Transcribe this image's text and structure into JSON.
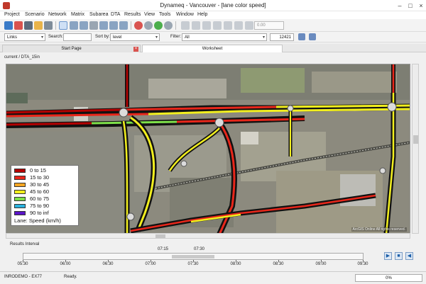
{
  "window": {
    "title": "Dynameq - Vancouver - [lane color speed]"
  },
  "menu": [
    "Project",
    "Scenario",
    "Network",
    "Matrix",
    "Subarea",
    "DTA",
    "Results",
    "View",
    "Tools",
    "Window",
    "Help"
  ],
  "toolbar": {
    "zoom_value": "0.00"
  },
  "filterbar": {
    "layer_select": "Links",
    "search_label": "Search:",
    "search_value": "",
    "sort_label": "Sort by:",
    "sort_value": "level",
    "filter_label": "Filter:",
    "filter_value": "All",
    "count": "12421"
  },
  "tabs": [
    {
      "label": "Start Page",
      "active": false
    },
    {
      "label": "Worksheet",
      "active": true
    }
  ],
  "breadcrumb": "current / DTA_15in",
  "legend": {
    "title": "Lane: Speed (km/h)",
    "items": [
      {
        "label": "0  to  15",
        "color": "#b30000"
      },
      {
        "label": "15  to  30",
        "color": "#e8261a"
      },
      {
        "label": "30  to  45",
        "color": "#f5a623"
      },
      {
        "label": "45  to  60",
        "color": "#f2ef1e"
      },
      {
        "label": "60  to  75",
        "color": "#7ee04a"
      },
      {
        "label": "75  to  90",
        "color": "#2bb3e0"
      },
      {
        "label": "90  to  inf",
        "color": "#5b14c9"
      }
    ]
  },
  "map": {
    "attribution": "ArcGIS Online   All rights reserved."
  },
  "results": {
    "label": "Results Interval",
    "range_start": "07:15",
    "range_end": "07:30",
    "ticks": [
      "05:30",
      "06:00",
      "06:30",
      "07:00",
      "07:30",
      "08:00",
      "08:30",
      "09:00",
      "09:30"
    ],
    "range_start_fraction": 0.4375,
    "range_end_fraction": 0.5625
  },
  "status": {
    "project": "INRODEMO - EX77",
    "message": "Ready.",
    "progress": "0%"
  }
}
